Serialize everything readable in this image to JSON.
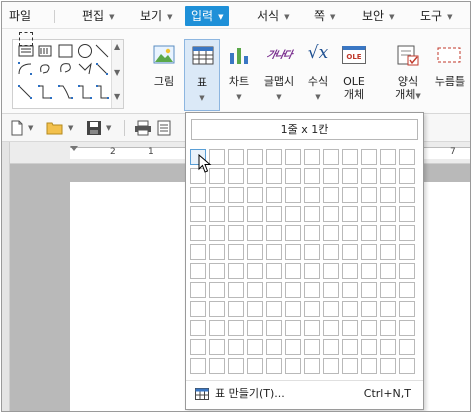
{
  "menubar": {
    "items": [
      {
        "label": "파일",
        "has_arrow": false,
        "active": false
      },
      {
        "label": "편집",
        "has_arrow": true,
        "active": false
      },
      {
        "label": "보기",
        "has_arrow": true,
        "active": false
      },
      {
        "label": "입력",
        "has_arrow": true,
        "active": true
      },
      {
        "label": "서식",
        "has_arrow": true,
        "active": false
      },
      {
        "label": "쪽",
        "has_arrow": true,
        "active": false
      },
      {
        "label": "보안",
        "has_arrow": true,
        "active": false
      },
      {
        "label": "도구",
        "has_arrow": true,
        "active": false
      }
    ]
  },
  "ribbon": {
    "picture_label": "그림",
    "table_label": "표",
    "chart_label": "차트",
    "glyph_label": "글맵시",
    "formula_label": "수식",
    "ole_label_1": "OLE",
    "ole_label_2": "개체",
    "ole_icon_text": "OLE",
    "form_label_1": "양식",
    "form_label_2": "개체",
    "click_label": "누름틀",
    "glyph_icon_text": "가나다"
  },
  "ruler": {
    "numbers": [
      "2",
      "1",
      "7"
    ]
  },
  "table_dropdown": {
    "grid_status": "1줄 x 1칸",
    "rows": 12,
    "cols": 12,
    "selected_rows": 1,
    "selected_cols": 1,
    "menu_item_label": "표 만들기(T)...",
    "menu_item_shortcut": "Ctrl+N,T"
  },
  "colors": {
    "accent": "#1e90d8",
    "selection": "#dbe9f7"
  }
}
